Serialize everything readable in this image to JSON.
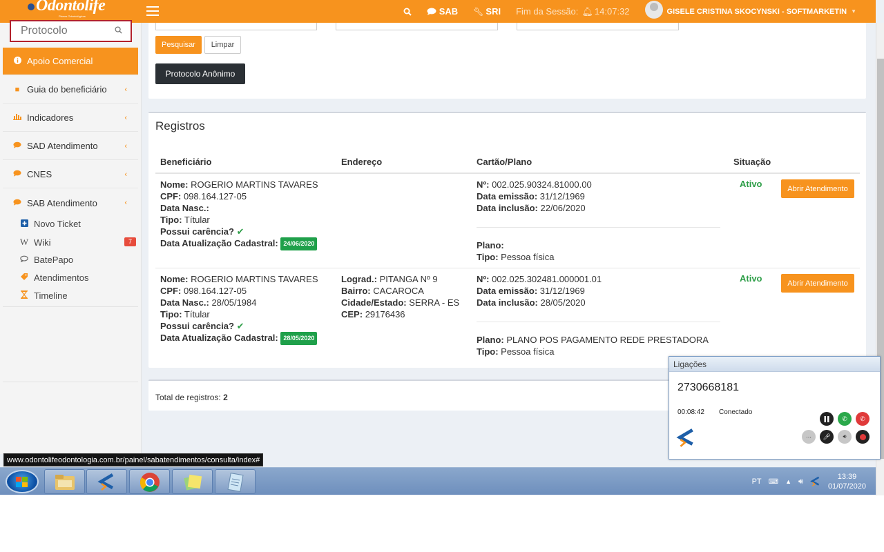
{
  "header": {
    "logo_text": "Odontolife",
    "logo_sub": "Planos Odontológicos",
    "search_icon": "search-icon",
    "sab_label": "SAB",
    "sri_label": "SRI",
    "session_label": "Fim da Sessão:",
    "session_time": "14:07:32",
    "user_name": "GISELE CRISTINA SKOCYNSKI - SOFTMARKETIN"
  },
  "sidebar": {
    "search_placeholder": "Protocolo",
    "items": [
      {
        "label": "Apoio Comercial",
        "icon": "info-icon",
        "active": true
      },
      {
        "label": "Guia do beneficiário",
        "icon": "book-icon"
      },
      {
        "label": "Indicadores",
        "icon": "bar-chart-icon"
      },
      {
        "label": "SAD Atendimento",
        "icon": "chat-icon"
      },
      {
        "label": "CNES",
        "icon": "chat-icon"
      },
      {
        "label": "SAB Atendimento",
        "icon": "chat-icon"
      }
    ],
    "subitems": [
      {
        "label": "Novo Ticket",
        "icon": "plus-square-icon"
      },
      {
        "label": "Wiki",
        "icon": "wikipedia-icon",
        "badge": "7"
      },
      {
        "label": "BatePapo",
        "icon": "chat-outline-icon"
      },
      {
        "label": "Atendimentos",
        "icon": "tag-icon"
      },
      {
        "label": "Timeline",
        "icon": "hourglass-icon"
      }
    ]
  },
  "search_panel": {
    "search_button": "Pesquisar",
    "clear_button": "Limpar",
    "anon_button": "Protocolo Anônimo"
  },
  "records": {
    "title": "Registros",
    "columns": [
      "Beneficiário",
      "Endereço",
      "Cartão/Plano",
      "Situação"
    ],
    "rows": [
      {
        "nome_label": "Nome:",
        "nome": "ROGERIO MARTINS TAVARES",
        "cpf_label": "CPF:",
        "cpf": "098.164.127-05",
        "nasc_label": "Data Nasc.:",
        "nasc": "",
        "tipo_label": "Tipo:",
        "tipo": "Títular",
        "carencia_label": "Possui carência?",
        "atual_label": "Data Atualização Cadastral:",
        "atual": "24/06/2020",
        "lograd_label": "",
        "lograd": "",
        "bairro_label": "",
        "bairro": "",
        "cidade_label": "",
        "cidade": "",
        "cep_label": "",
        "cep": "",
        "num_label": "Nº:",
        "num": "002.025.90324.81000.00",
        "emissao_label": "Data emissão:",
        "emissao": "31/12/1969",
        "inclusao_label": "Data inclusão:",
        "inclusao": "22/06/2020",
        "plano_label": "Plano:",
        "plano": "",
        "ptipo_label": "Tipo:",
        "ptipo": "Pessoa física",
        "status": "Ativo",
        "action": "Abrir Atendimento"
      },
      {
        "nome_label": "Nome:",
        "nome": "ROGERIO MARTINS TAVARES",
        "cpf_label": "CPF:",
        "cpf": "098.164.127-05",
        "nasc_label": "Data Nasc.:",
        "nasc": "28/05/1984",
        "tipo_label": "Tipo:",
        "tipo": "Títular",
        "carencia_label": "Possui carência?",
        "atual_label": "Data Atualização Cadastral:",
        "atual": "28/05/2020",
        "lograd_label": "Lograd.:",
        "lograd": "PITANGA Nº 9",
        "bairro_label": "Bairro:",
        "bairro": "CACAROCA",
        "cidade_label": "Cidade/Estado:",
        "cidade": "SERRA - ES",
        "cep_label": "CEP:",
        "cep": "29176436",
        "num_label": "Nº:",
        "num": "002.025.302481.000001.01",
        "emissao_label": "Data emissão:",
        "emissao": "31/12/1969",
        "inclusao_label": "Data inclusão:",
        "inclusao": "28/05/2020",
        "plano_label": "Plano:",
        "plano": "PLANO POS PAGAMENTO REDE PRESTADORA",
        "ptipo_label": "Tipo:",
        "ptipo": "Pessoa física",
        "status": "Ativo",
        "action": "Abrir Atendimento"
      }
    ],
    "total_label": "Total de registros:",
    "total": "2"
  },
  "statusbar_url": "www.odontolifeodontologia.com.br/painel/sabatendimentos/consulta/index#",
  "softphone": {
    "title": "Ligações",
    "number": "2730668181",
    "duration": "00:08:42",
    "state": "Conectado"
  },
  "taskbar": {
    "lang": "PT",
    "time": "13:39",
    "date": "01/07/2020"
  },
  "colors": {
    "accent": "#f7931e",
    "active_status": "#2e9e48",
    "dark_button": "#2b3035"
  }
}
